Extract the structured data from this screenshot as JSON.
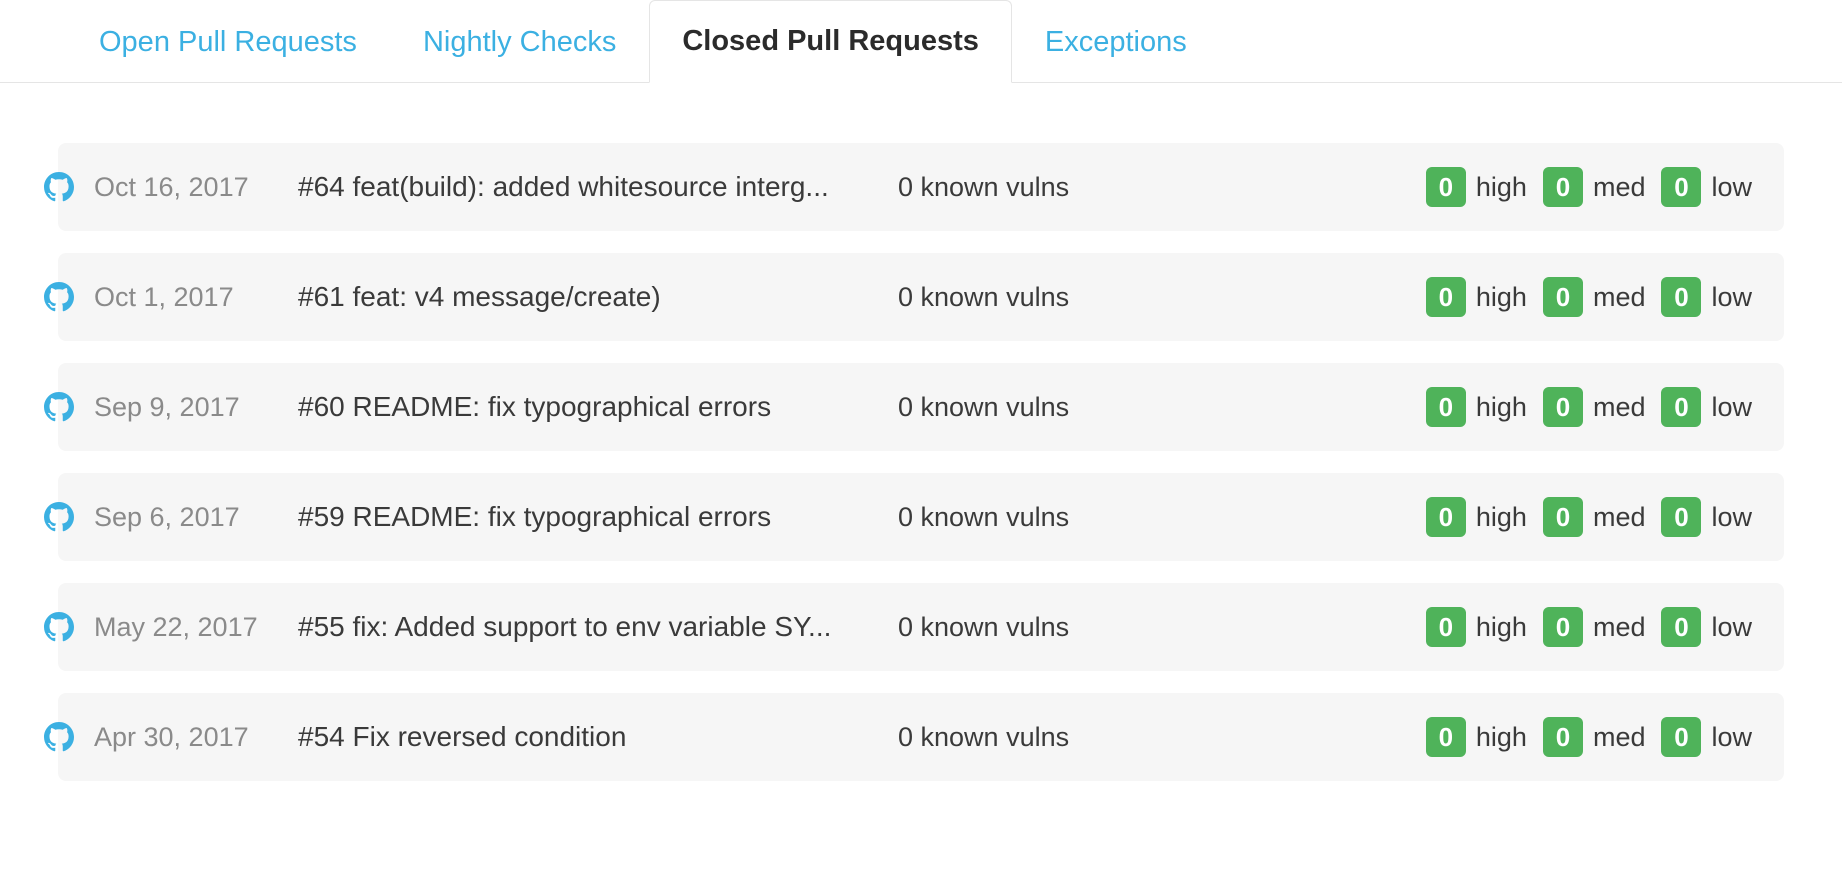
{
  "tabs": [
    {
      "label": "Open Pull Requests",
      "active": false
    },
    {
      "label": "Nightly Checks",
      "active": false
    },
    {
      "label": "Closed Pull Requests",
      "active": true
    },
    {
      "label": "Exceptions",
      "active": false
    }
  ],
  "labels": {
    "high": "high",
    "med": "med",
    "low": "low"
  },
  "rows": [
    {
      "date": "Oct 16, 2017",
      "title": "#64 feat(build): added whitesource interg...",
      "vulns": "0 known vulns",
      "high": "0",
      "med": "0",
      "low": "0"
    },
    {
      "date": "Oct 1, 2017",
      "title": "#61 feat: v4 message/create)",
      "vulns": "0 known vulns",
      "high": "0",
      "med": "0",
      "low": "0"
    },
    {
      "date": "Sep 9, 2017",
      "title": "#60 README: fix typographical errors",
      "vulns": "0 known vulns",
      "high": "0",
      "med": "0",
      "low": "0"
    },
    {
      "date": "Sep 6, 2017",
      "title": "#59 README: fix typographical errors",
      "vulns": "0 known vulns",
      "high": "0",
      "med": "0",
      "low": "0"
    },
    {
      "date": "May 22, 2017",
      "title": "#55 fix: Added support to env variable SY...",
      "vulns": "0 known vulns",
      "high": "0",
      "med": "0",
      "low": "0"
    },
    {
      "date": "Apr 30, 2017",
      "title": "#54 Fix reversed condition",
      "vulns": "0 known vulns",
      "high": "0",
      "med": "0",
      "low": "0"
    }
  ],
  "colors": {
    "accent": "#3bb0e2",
    "badge": "#4fb35a",
    "rowBg": "#f6f6f6"
  }
}
